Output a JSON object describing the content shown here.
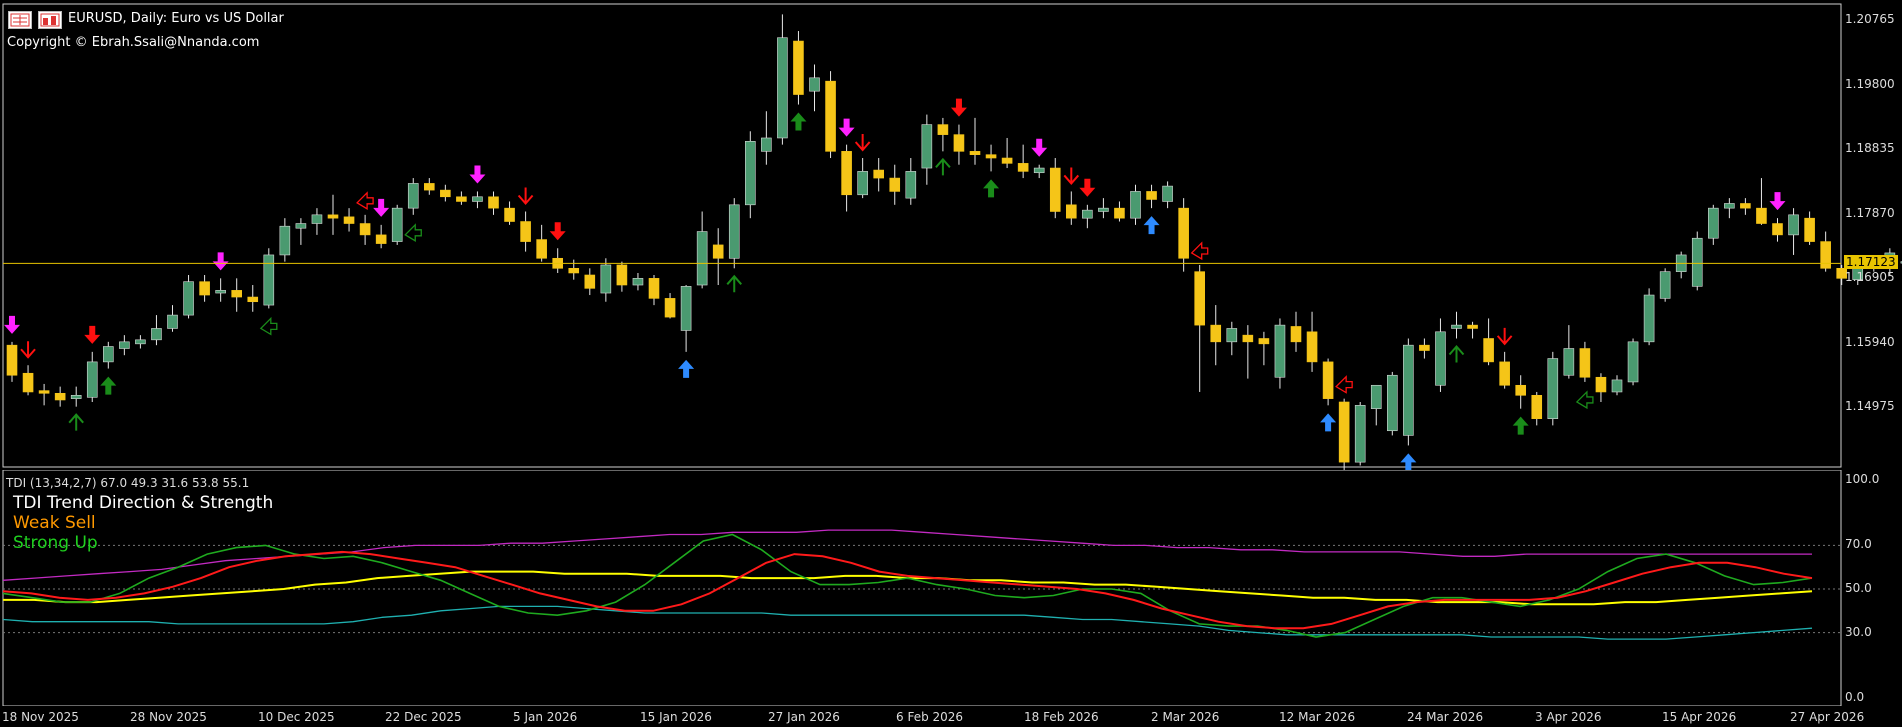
{
  "window": {
    "title": "EURUSD, Daily:  Euro vs US Dollar",
    "copyright": "Copyright © Ebrah.Ssali@Nnanda.com"
  },
  "colors": {
    "background": "#000000",
    "bull_candle": "#4a9a70",
    "bear_candle": "#f5c518",
    "signal_up_green": "#1a8c1a",
    "signal_up_blue": "#2e8bff",
    "signal_down_red": "#ff1010",
    "signal_down_magenta": "#ff22ff",
    "price_line": "#e8c400",
    "tdi_red": "#ff1a1a",
    "tdi_green": "#1faa1f",
    "tdi_yellow": "#ffff00",
    "tdi_magenta": "#c22ac2",
    "tdi_cyan": "#1fb0b0"
  },
  "price_axis": {
    "labels": [
      "1.20765",
      "1.19800",
      "1.18835",
      "1.17870",
      "1.16905",
      "1.15940",
      "1.14975"
    ],
    "current_price": "1.17123"
  },
  "tdi": {
    "params": "TDI (13,34,2,7) 67.0 49.3 31.6 53.8 55.1",
    "title": "TDI Trend Direction & Strength",
    "signal1": "Weak Sell",
    "signal2": "Strong Up",
    "axis_labels": [
      "100.0",
      "70.0",
      "50.0",
      "30.0",
      "0.0"
    ],
    "levels": [
      70,
      50,
      30
    ]
  },
  "time_axis": {
    "labels": [
      "18 Nov 2025",
      "28 Nov 2025",
      "10 Dec 2025",
      "22 Dec 2025",
      "5 Jan 2026",
      "15 Jan 2026",
      "27 Jan 2026",
      "6 Feb 2026",
      "18 Feb 2026",
      "2 Mar 2026",
      "12 Mar 2026",
      "24 Mar 2026",
      "3 Apr 2026",
      "15 Apr 2026",
      "27 Apr 2026"
    ]
  },
  "candles": [
    [
      1.159,
      1.1595,
      1.1535,
      1.1545
    ],
    [
      1.1548,
      1.156,
      1.1515,
      1.152
    ],
    [
      1.1522,
      1.1532,
      1.15,
      1.1518
    ],
    [
      1.1518,
      1.1528,
      1.1498,
      1.1508
    ],
    [
      1.151,
      1.1528,
      1.1498,
      1.1515
    ],
    [
      1.1512,
      1.158,
      1.1505,
      1.1565
    ],
    [
      1.1565,
      1.1595,
      1.1555,
      1.1588
    ],
    [
      1.1585,
      1.1605,
      1.1575,
      1.1595
    ],
    [
      1.1592,
      1.1605,
      1.1585,
      1.1598
    ],
    [
      1.1598,
      1.1635,
      1.159,
      1.1615
    ],
    [
      1.1615,
      1.165,
      1.161,
      1.1635
    ],
    [
      1.1635,
      1.1695,
      1.163,
      1.1685
    ],
    [
      1.1685,
      1.1695,
      1.1655,
      1.1665
    ],
    [
      1.1668,
      1.169,
      1.1655,
      1.1672
    ],
    [
      1.1672,
      1.169,
      1.164,
      1.1662
    ],
    [
      1.1662,
      1.168,
      1.164,
      1.1655
    ],
    [
      1.165,
      1.1735,
      1.1645,
      1.1725
    ],
    [
      1.1725,
      1.178,
      1.1715,
      1.1768
    ],
    [
      1.1765,
      1.178,
      1.174,
      1.1772
    ],
    [
      1.1772,
      1.1795,
      1.1755,
      1.1785
    ],
    [
      1.1785,
      1.1815,
      1.1755,
      1.178
    ],
    [
      1.1782,
      1.1795,
      1.176,
      1.1772
    ],
    [
      1.1772,
      1.1785,
      1.174,
      1.1755
    ],
    [
      1.1755,
      1.177,
      1.1735,
      1.1742
    ],
    [
      1.1745,
      1.18,
      1.174,
      1.1795
    ],
    [
      1.1795,
      1.184,
      1.1785,
      1.1832
    ],
    [
      1.1832,
      1.184,
      1.1815,
      1.1822
    ],
    [
      1.1822,
      1.183,
      1.1805,
      1.1812
    ],
    [
      1.1812,
      1.182,
      1.18,
      1.1805
    ],
    [
      1.1805,
      1.182,
      1.1795,
      1.1812
    ],
    [
      1.1812,
      1.182,
      1.1785,
      1.1795
    ],
    [
      1.1795,
      1.1805,
      1.177,
      1.1775
    ],
    [
      1.1775,
      1.179,
      1.173,
      1.1745
    ],
    [
      1.1748,
      1.177,
      1.1715,
      1.172
    ],
    [
      1.172,
      1.1735,
      1.1698,
      1.1705
    ],
    [
      1.1705,
      1.1718,
      1.1688,
      1.1698
    ],
    [
      1.1695,
      1.1705,
      1.1665,
      1.1675
    ],
    [
      1.1668,
      1.172,
      1.1655,
      1.171
    ],
    [
      1.171,
      1.1715,
      1.167,
      1.168
    ],
    [
      1.168,
      1.1698,
      1.1672,
      1.169
    ],
    [
      1.169,
      1.1695,
      1.165,
      1.166
    ],
    [
      1.166,
      1.1668,
      1.163,
      1.1632
    ],
    [
      1.1612,
      1.168,
      1.158,
      1.1678
    ],
    [
      1.168,
      1.179,
      1.1675,
      1.176
    ],
    [
      1.174,
      1.1765,
      1.168,
      1.172
    ],
    [
      1.172,
      1.181,
      1.1705,
      1.18
    ],
    [
      1.18,
      1.191,
      1.178,
      1.1895
    ],
    [
      1.188,
      1.194,
      1.186,
      1.19
    ],
    [
      1.19,
      1.2085,
      1.189,
      1.205
    ],
    [
      1.2045,
      1.206,
      1.195,
      1.1965
    ],
    [
      1.197,
      1.201,
      1.194,
      1.199
    ],
    [
      1.1985,
      1.2,
      1.187,
      1.188
    ],
    [
      1.188,
      1.189,
      1.179,
      1.1815
    ],
    [
      1.1815,
      1.187,
      1.181,
      1.185
    ],
    [
      1.1852,
      1.187,
      1.182,
      1.184
    ],
    [
      1.184,
      1.186,
      1.18,
      1.182
    ],
    [
      1.181,
      1.187,
      1.18,
      1.185
    ],
    [
      1.1855,
      1.1935,
      1.183,
      1.192
    ],
    [
      1.192,
      1.193,
      1.188,
      1.1905
    ],
    [
      1.1905,
      1.192,
      1.186,
      1.188
    ],
    [
      1.188,
      1.193,
      1.186,
      1.1875
    ],
    [
      1.1875,
      1.189,
      1.185,
      1.187
    ],
    [
      1.187,
      1.19,
      1.1855,
      1.1862
    ],
    [
      1.1862,
      1.189,
      1.184,
      1.185
    ],
    [
      1.1848,
      1.186,
      1.184,
      1.1855
    ],
    [
      1.1855,
      1.187,
      1.178,
      1.179
    ],
    [
      1.18,
      1.182,
      1.177,
      1.178
    ],
    [
      1.178,
      1.18,
      1.1765,
      1.1792
    ],
    [
      1.179,
      1.181,
      1.178,
      1.1795
    ],
    [
      1.1795,
      1.1805,
      1.1775,
      1.178
    ],
    [
      1.178,
      1.183,
      1.177,
      1.182
    ],
    [
      1.182,
      1.183,
      1.1795,
      1.1808
    ],
    [
      1.1805,
      1.1835,
      1.1795,
      1.1828
    ],
    [
      1.1795,
      1.181,
      1.17,
      1.172
    ],
    [
      1.17,
      1.171,
      1.152,
      1.162
    ],
    [
      1.162,
      1.165,
      1.156,
      1.1595
    ],
    [
      1.1595,
      1.1625,
      1.1575,
      1.1615
    ],
    [
      1.1605,
      1.162,
      1.154,
      1.1595
    ],
    [
      1.16,
      1.161,
      1.156,
      1.1592
    ],
    [
      1.1542,
      1.163,
      1.1525,
      1.162
    ],
    [
      1.1618,
      1.164,
      1.158,
      1.1595
    ],
    [
      1.161,
      1.164,
      1.155,
      1.1565
    ],
    [
      1.1565,
      1.157,
      1.15,
      1.151
    ],
    [
      1.1505,
      1.151,
      1.14,
      1.1415
    ],
    [
      1.1415,
      1.1505,
      1.141,
      1.15
    ],
    [
      1.1495,
      1.153,
      1.147,
      1.153
    ],
    [
      1.1462,
      1.155,
      1.1455,
      1.1545
    ],
    [
      1.1455,
      1.16,
      1.144,
      1.159
    ],
    [
      1.159,
      1.16,
      1.157,
      1.1582
    ],
    [
      1.153,
      1.163,
      1.152,
      1.161
    ],
    [
      1.1615,
      1.164,
      1.16,
      1.162
    ],
    [
      1.162,
      1.1625,
      1.16,
      1.1615
    ],
    [
      1.16,
      1.163,
      1.156,
      1.1565
    ],
    [
      1.1565,
      1.158,
      1.1525,
      1.153
    ],
    [
      1.153,
      1.1545,
      1.1495,
      1.1515
    ],
    [
      1.1515,
      1.152,
      1.147,
      1.148
    ],
    [
      1.148,
      1.158,
      1.147,
      1.157
    ],
    [
      1.1545,
      1.162,
      1.154,
      1.1585
    ],
    [
      1.1585,
      1.1595,
      1.1535,
      1.1542
    ],
    [
      1.1542,
      1.1548,
      1.1505,
      1.152
    ],
    [
      1.152,
      1.1545,
      1.1515,
      1.1538
    ],
    [
      1.1535,
      1.16,
      1.153,
      1.1595
    ],
    [
      1.1595,
      1.1675,
      1.159,
      1.1665
    ],
    [
      1.166,
      1.1705,
      1.1655,
      1.17
    ],
    [
      1.17,
      1.173,
      1.169,
      1.1725
    ],
    [
      1.1678,
      1.176,
      1.1672,
      1.175
    ],
    [
      1.175,
      1.18,
      1.174,
      1.1795
    ],
    [
      1.1795,
      1.181,
      1.178,
      1.1802
    ],
    [
      1.1802,
      1.181,
      1.1785,
      1.1795
    ],
    [
      1.1795,
      1.184,
      1.177,
      1.1772
    ],
    [
      1.1772,
      1.178,
      1.1745,
      1.1755
    ],
    [
      1.1755,
      1.1795,
      1.1725,
      1.1785
    ],
    [
      1.178,
      1.179,
      1.174,
      1.1745
    ],
    [
      1.1745,
      1.176,
      1.17,
      1.1705
    ],
    [
      1.1705,
      1.171,
      1.168,
      1.169
    ],
    [
      1.1688,
      1.172,
      1.168,
      1.1715
    ],
    [
      1.1715,
      1.172,
      1.17,
      1.171
    ],
    [
      1.1705,
      1.1735,
      1.1695,
      1.1728
    ],
    [
      1.1715,
      1.1725,
      1.168,
      1.1715
    ]
  ],
  "signals": [
    {
      "bar": 0,
      "type": "down-bold",
      "color": "#ff22ff"
    },
    {
      "bar": 1,
      "type": "down-thin",
      "color": "#ff1010"
    },
    {
      "bar": 4,
      "type": "up-thin",
      "color": "#1a8c1a"
    },
    {
      "bar": 5,
      "type": "down-bold",
      "color": "#ff1010"
    },
    {
      "bar": 6,
      "type": "up-bold",
      "color": "#1a8c1a"
    },
    {
      "bar": 13,
      "type": "down-bold",
      "color": "#ff22ff"
    },
    {
      "bar": 16,
      "type": "up-hollow",
      "color": "#1a8c1a"
    },
    {
      "bar": 22,
      "type": "down-hollow",
      "color": "#ff1010"
    },
    {
      "bar": 23,
      "type": "down-bold",
      "color": "#ff22ff"
    },
    {
      "bar": 25,
      "type": "up-hollow",
      "color": "#1a8c1a"
    },
    {
      "bar": 29,
      "type": "down-bold",
      "color": "#ff22ff"
    },
    {
      "bar": 32,
      "type": "down-thin",
      "color": "#ff1010"
    },
    {
      "bar": 34,
      "type": "down-bold",
      "color": "#ff1010"
    },
    {
      "bar": 42,
      "type": "up-bold",
      "color": "#2e8bff"
    },
    {
      "bar": 45,
      "type": "up-thin",
      "color": "#1a8c1a"
    },
    {
      "bar": 49,
      "type": "up-bold",
      "color": "#1a8c1a"
    },
    {
      "bar": 52,
      "type": "down-bold",
      "color": "#ff22ff"
    },
    {
      "bar": 53,
      "type": "down-thin",
      "color": "#ff1010"
    },
    {
      "bar": 58,
      "type": "up-thin",
      "color": "#1a8c1a"
    },
    {
      "bar": 59,
      "type": "down-bold",
      "color": "#ff1010"
    },
    {
      "bar": 61,
      "type": "up-bold",
      "color": "#1a8c1a"
    },
    {
      "bar": 64,
      "type": "down-bold",
      "color": "#ff22ff"
    },
    {
      "bar": 66,
      "type": "down-thin",
      "color": "#ff1010"
    },
    {
      "bar": 67,
      "type": "down-bold",
      "color": "#ff1010"
    },
    {
      "bar": 71,
      "type": "up-bold",
      "color": "#2e8bff"
    },
    {
      "bar": 74,
      "type": "down-hollow",
      "color": "#ff1010"
    },
    {
      "bar": 82,
      "type": "up-bold",
      "color": "#2e8bff"
    },
    {
      "bar": 83,
      "type": "down-hollow",
      "color": "#ff1010"
    },
    {
      "bar": 87,
      "type": "up-bold",
      "color": "#2e8bff"
    },
    {
      "bar": 90,
      "type": "up-thin",
      "color": "#1a8c1a"
    },
    {
      "bar": 93,
      "type": "down-thin",
      "color": "#ff1010"
    },
    {
      "bar": 94,
      "type": "up-bold",
      "color": "#1a8c1a"
    },
    {
      "bar": 98,
      "type": "up-hollow",
      "color": "#1a8c1a"
    },
    {
      "bar": 110,
      "type": "down-bold",
      "color": "#ff22ff"
    }
  ],
  "tdi_series": {
    "magenta": [
      54,
      55,
      56,
      57,
      58,
      59,
      61,
      63,
      64,
      65,
      66,
      67,
      69,
      70,
      70,
      70,
      71,
      71,
      72,
      73,
      74,
      75,
      75,
      76,
      76,
      76,
      77,
      77,
      77,
      76,
      75,
      74,
      73,
      72,
      71,
      70,
      70,
      69,
      69,
      68,
      68,
      67,
      67,
      67,
      67,
      66,
      65,
      65,
      66,
      66,
      66,
      66,
      66,
      66,
      66,
      66,
      66,
      66
    ],
    "cyan": [
      36,
      35,
      35,
      35,
      35,
      35,
      34,
      34,
      34,
      34,
      34,
      34,
      35,
      37,
      38,
      40,
      41,
      42,
      42,
      42,
      41,
      40,
      39,
      39,
      39,
      39,
      39,
      38,
      38,
      38,
      38,
      38,
      38,
      38,
      38,
      38,
      37,
      36,
      36,
      35,
      34,
      33,
      31,
      30,
      29,
      29,
      29,
      29,
      29,
      29,
      29,
      28,
      28,
      28,
      28,
      27,
      27,
      27,
      28,
      29,
      30,
      31,
      32
    ],
    "yellow": [
      45,
      45,
      44,
      44,
      45,
      46,
      47,
      48,
      49,
      50,
      52,
      53,
      55,
      56,
      57,
      58,
      58,
      58,
      57,
      57,
      57,
      56,
      56,
      56,
      55,
      55,
      55,
      56,
      56,
      55,
      55,
      54,
      54,
      53,
      53,
      52,
      52,
      51,
      50,
      49,
      48,
      47,
      46,
      46,
      45,
      45,
      44,
      44,
      44,
      43,
      43,
      43,
      44,
      44,
      45,
      46,
      47,
      48,
      49
    ],
    "red": [
      49,
      48,
      46,
      45,
      46,
      48,
      51,
      55,
      60,
      63,
      65,
      66,
      67,
      66,
      64,
      62,
      60,
      56,
      52,
      48,
      45,
      42,
      40,
      40,
      43,
      48,
      55,
      62,
      66,
      65,
      62,
      58,
      56,
      55,
      54,
      53,
      52,
      51,
      50,
      48,
      45,
      41,
      38,
      35,
      33,
      32,
      32,
      34,
      38,
      42,
      44,
      45,
      45,
      45,
      45,
      46,
      49,
      53,
      57,
      60,
      62,
      62,
      60,
      57,
      55
    ],
    "green": [
      48,
      46,
      44,
      44,
      48,
      55,
      60,
      66,
      69,
      70,
      66,
      64,
      65,
      62,
      58,
      54,
      48,
      42,
      39,
      38,
      40,
      44,
      52,
      62,
      72,
      75,
      68,
      58,
      52,
      52,
      53,
      55,
      52,
      50,
      47,
      46,
      47,
      50,
      50,
      48,
      40,
      34,
      33,
      33,
      31,
      28,
      30,
      36,
      42,
      46,
      46,
      44,
      42,
      45,
      50,
      58,
      64,
      66,
      62,
      56,
      52,
      53,
      55
    ]
  }
}
